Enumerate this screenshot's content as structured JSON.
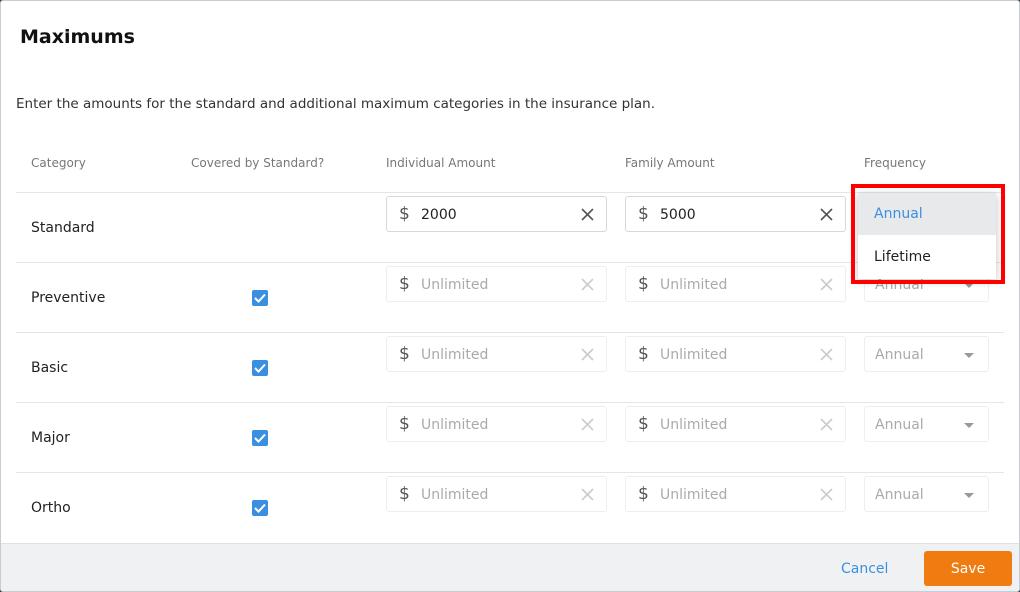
{
  "modal": {
    "title": "Maximums",
    "description": "Enter the amounts for the standard and additional maximum categories in the insurance plan."
  },
  "columns": {
    "category": "Category",
    "covered": "Covered by Standard?",
    "individual": "Individual Amount",
    "family": "Family Amount",
    "frequency": "Frequency"
  },
  "rows": [
    {
      "label": "Standard",
      "covered": null,
      "individual": "2000",
      "family": "5000",
      "individual_placeholder": "",
      "family_placeholder": "",
      "frequency": "Annual"
    },
    {
      "label": "Preventive",
      "covered": true,
      "individual": "",
      "family": "",
      "individual_placeholder": "Unlimited",
      "family_placeholder": "Unlimited",
      "frequency": "Annual"
    },
    {
      "label": "Basic",
      "covered": true,
      "individual": "",
      "family": "",
      "individual_placeholder": "Unlimited",
      "family_placeholder": "Unlimited",
      "frequency": "Annual"
    },
    {
      "label": "Major",
      "covered": true,
      "individual": "",
      "family": "",
      "individual_placeholder": "Unlimited",
      "family_placeholder": "Unlimited",
      "frequency": "Annual"
    },
    {
      "label": "Ortho",
      "covered": true,
      "individual": "",
      "family": "",
      "individual_placeholder": "Unlimited",
      "family_placeholder": "Unlimited",
      "frequency": "Annual"
    }
  ],
  "dropdown": {
    "options": [
      "Annual",
      "Lifetime"
    ],
    "selected": "Annual"
  },
  "footer": {
    "cancel_label": "Cancel",
    "save_label": "Save"
  },
  "icons": {
    "currency": "dollar-icon",
    "clear": "close-icon",
    "checkbox": "check-icon",
    "select_caret": "caret-down-icon"
  },
  "colors": {
    "accent": "#3b8fe0",
    "save": "#f07b10",
    "highlight": "#ff0000"
  }
}
